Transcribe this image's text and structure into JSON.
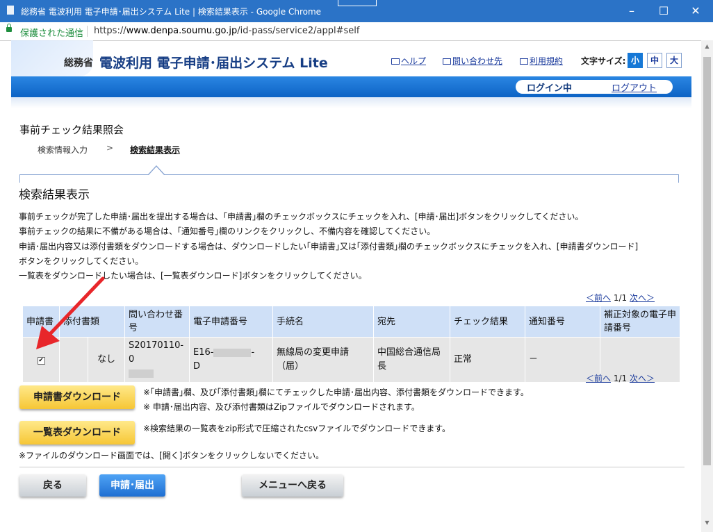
{
  "window": {
    "title": "総務省 電波利用 電子申請･届出システム Lite | 検索結果表示 - Google Chrome",
    "controls": {
      "minimize": "–",
      "maximize": "☐",
      "close": "✕"
    }
  },
  "address": {
    "secure_label": "保護された通信",
    "url_scheme": "https://",
    "url_host": "www.denpa.soumu.go.jp",
    "url_path": "/id-pass/service2/appl#self"
  },
  "header": {
    "ministry": "総務省",
    "system_title": "電波利用 電子申請･届出システム Lite",
    "links": {
      "help": "ヘルプ",
      "contact": "問い合わせ先",
      "terms": "利用規約"
    },
    "font_size_label": "文字サイズ:",
    "font_sizes": {
      "small": "小",
      "medium": "中",
      "large": "大"
    },
    "login_status": "ログイン中",
    "logout": "ログアウト"
  },
  "page": {
    "title": "事前チェック結果照会",
    "breadcrumb": {
      "step1": "検索情報入力",
      "sep": ">",
      "step2": "検索結果表示"
    },
    "section_title": "検索結果表示",
    "instructions": [
      "事前チェックが完了した申請･届出を提出する場合は、｢申請書｣欄のチェックボックスにチェックを入れ、[申請･届出]ボタンをクリックしてください。",
      "事前チェックの結果に不備がある場合は、｢通知番号｣欄のリンクをクリックし、不備内容を確認してください。",
      "申請･届出内容又は添付書類をダウンロードする場合は、ダウンロードしたい｢申請書｣又は｢添付書類｣欄のチェックボックスにチェックを入れ、[申請書ダウンロード]",
      "ボタンをクリックしてください。",
      "一覧表をダウンロードしたい場合は、[一覧表ダウンロード]ボタンをクリックしてください。"
    ]
  },
  "pager": {
    "prev": "＜前へ",
    "current": "1",
    "sep": "/",
    "total": "1",
    "next": "次へ＞"
  },
  "table": {
    "headers": {
      "application": "申請書",
      "attachments": "添付書類",
      "inquiry_no": "問い合わせ番号",
      "e_app_no": "電子申請番号",
      "procedure": "手続名",
      "destination": "宛先",
      "check_result": "チェック結果",
      "notice_no": "通知番号",
      "correction_e_app_no": "補正対象の電子申請番号"
    },
    "row": {
      "attachments": "なし",
      "inquiry_no": "S20170110-0",
      "e_app_no_prefix": "E16-",
      "e_app_no_dash": "-",
      "e_app_no_suffix": "D",
      "procedure": "無線局の変更申請（届）",
      "destination": "中国総合通信局長",
      "check_result": "正常",
      "notice_no": "－",
      "correction_e_app_no": ""
    }
  },
  "actions": {
    "download_app": "申請書ダウンロード",
    "download_app_note1": "※｢申請書｣欄、及び｢添付書類｣欄にてチェックした申請･届出内容、添付書類をダウンロードできます。",
    "download_app_note2": "※ 申請･届出内容、及び添付書類はZipファイルでダウンロードされます。",
    "download_list": "一覧表ダウンロード",
    "download_list_note": "※検索結果の一覧表をzip形式で圧縮されたcsvファイルでダウンロードできます。",
    "file_note": "※ファイルのダウンロード画面では、[開く]ボタンをクリックしないでください。",
    "back": "戻る",
    "submit": "申請･届出",
    "menu": "メニューへ戻る"
  },
  "colors": {
    "titlebar": "#2b73c7",
    "header_bar": "#0d63c5",
    "table_header": "#cfe0f7",
    "download_button": "#f6c635",
    "submit_button": "#1f6fd2",
    "annotation_arrow": "#e8262a"
  }
}
